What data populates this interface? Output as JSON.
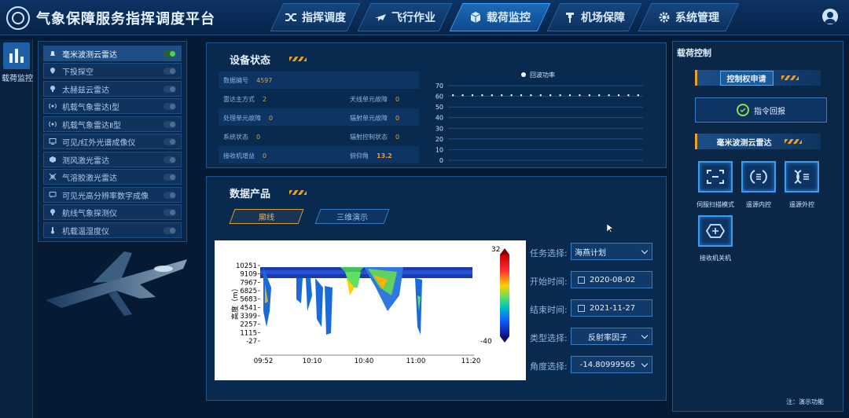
{
  "app": {
    "title": "气象保障服务指挥调度平台"
  },
  "nav": {
    "tabs": [
      {
        "label": "指挥调度",
        "icon": "shuffle-icon"
      },
      {
        "label": "飞行作业",
        "icon": "plane-icon"
      },
      {
        "label": "载荷监控",
        "icon": "cube-icon"
      },
      {
        "label": "机场保障",
        "icon": "tower-icon"
      },
      {
        "label": "系统管理",
        "icon": "gear-icon"
      }
    ]
  },
  "rail": {
    "label": "载荷监控"
  },
  "devices": [
    {
      "label": "毫米波测云雷达",
      "on": true
    },
    {
      "label": "下投探空",
      "on": false
    },
    {
      "label": "太赫兹云雷达",
      "on": false
    },
    {
      "label": "机载气象雷达Ⅰ型",
      "on": false
    },
    {
      "label": "机载气象雷达Ⅱ型",
      "on": false
    },
    {
      "label": "可见/红外光谱成像仪",
      "on": false
    },
    {
      "label": "测风激光雷达",
      "on": false
    },
    {
      "label": "气溶胶激光雷达",
      "on": false
    },
    {
      "label": "可见光高分辨率数字成像",
      "on": false
    },
    {
      "label": "航线气象探测仪",
      "on": false
    },
    {
      "label": "机载温湿度仪",
      "on": false
    }
  ],
  "status": {
    "title": "设备状态",
    "fields": {
      "data_no": {
        "label": "数据编号",
        "value": "4597"
      },
      "radar_mode": {
        "label": "雷达主方式",
        "value": "2"
      },
      "antenna_fault": {
        "label": "天线单元故障",
        "value": "0"
      },
      "proc_fault": {
        "label": "处理单元故障",
        "value": "0"
      },
      "tx_fault": {
        "label": "辐射单元故障",
        "value": "0"
      },
      "sys_state": {
        "label": "系统状态",
        "value": "0"
      },
      "tx_ctrl": {
        "label": "辐射控制状态",
        "value": "0"
      },
      "rx_gain": {
        "label": "接收机增益",
        "value": "0"
      },
      "pitch": {
        "label": "俯仰角",
        "value": "13.2"
      }
    }
  },
  "chart_data": {
    "type": "scatter",
    "series": [
      {
        "name": "回波功率",
        "values": [
          61,
          61,
          61,
          61,
          61,
          61,
          61,
          61,
          61,
          61,
          61,
          61,
          61,
          61,
          61,
          61,
          61,
          61,
          61,
          61
        ]
      }
    ],
    "yticks": [
      "70",
      "60",
      "50",
      "40",
      "30",
      "20",
      "10",
      "0"
    ],
    "ylim": [
      0,
      70
    ],
    "legend": "top-center",
    "grid": true
  },
  "products": {
    "title": "数据产品",
    "tabs": [
      {
        "label": "廓线"
      },
      {
        "label": "三维演示"
      }
    ],
    "radar": {
      "ylabel": "高度（m）",
      "yticks": [
        "10251",
        "9109",
        "7967",
        "6825",
        "5683",
        "4541",
        "3399",
        "2257",
        "1115",
        "-27"
      ],
      "xticks": [
        "09:52",
        "10:10",
        "10:40",
        "11:00",
        "11:20"
      ],
      "cbar_max": "32",
      "cbar_min": "-40"
    },
    "form": {
      "task": {
        "label": "任务选择:",
        "value": "海燕计划"
      },
      "start": {
        "label": "开始时间:",
        "value": "2020-08-02"
      },
      "end": {
        "label": "结束时间:",
        "value": "2021-11-27"
      },
      "type": {
        "label": "类型选择:",
        "value": "反射率因子"
      },
      "angle": {
        "label": "角度选择:",
        "value": "-14.80999565"
      }
    }
  },
  "payload": {
    "title": "载荷控制",
    "control_btn": "控制权申请",
    "report_btn": "指令回报",
    "radar_title": "毫米波测云雷达",
    "buttons": [
      {
        "label": "伺服扫描模式",
        "icon": "scan-frame-icon"
      },
      {
        "label": "遥源内控",
        "icon": "internal-control-icon"
      },
      {
        "label": "遥源外控",
        "icon": "external-control-icon"
      },
      {
        "label": "接收机关机",
        "icon": "receiver-power-icon"
      }
    ],
    "note": "注：演示功能"
  }
}
